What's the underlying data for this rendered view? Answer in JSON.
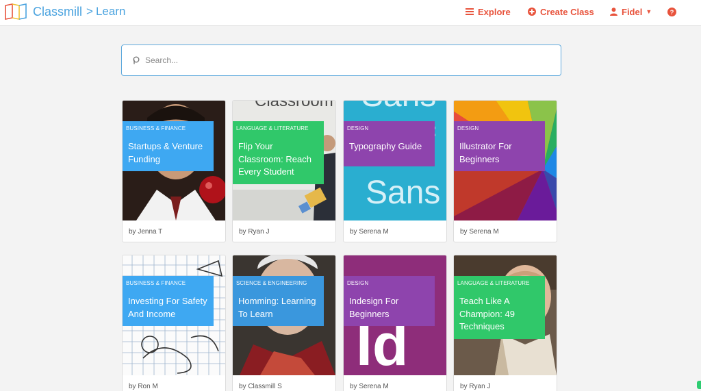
{
  "header": {
    "brand_name": "Classmill",
    "separator": ">",
    "section": "Learn",
    "nav": {
      "explore": "Explore",
      "create_class": "Create Class",
      "user": "Fidel",
      "help_icon": "question-circle-icon"
    }
  },
  "search": {
    "placeholder": "Search..."
  },
  "courses": [
    {
      "category": "Business & Finance",
      "title": "Startups & Venture Funding",
      "author": "by Jenna T",
      "color": "#3ea8f2"
    },
    {
      "category": "Language & Literature",
      "title": "Flip Your Classroom: Reach Every Student",
      "author": "by Ryan J",
      "color": "#30c86a",
      "image_text": "Classroom"
    },
    {
      "category": "Design",
      "title": "Typography Guide",
      "author": "by Serena M",
      "color": "#8e44ad",
      "image_text": "Sans"
    },
    {
      "category": "Design",
      "title": "Illustrator For Beginners",
      "author": "by Serena M",
      "color": "#8e44ad"
    },
    {
      "category": "Business & Finance",
      "title": "Investing For Safety And Income",
      "author": "by Ron M",
      "color": "#3ea8f2"
    },
    {
      "category": "Science & Engineering",
      "title": "Homming: Learning To Learn",
      "author": "by Classmill S",
      "color": "#3a97dd"
    },
    {
      "category": "Design",
      "title": "Indesign For Beginners",
      "author": "by Serena M",
      "color": "#8e44ad",
      "image_text": "Id"
    },
    {
      "category": "Language & Literature",
      "title": "Teach Like A Champion: 49 Techniques",
      "author": "by Ryan J",
      "color": "#30c86a"
    }
  ],
  "colors": {
    "accent": "#e8533c",
    "brand": "#4aa3df",
    "blue": "#3ea8f2",
    "green": "#30c86a",
    "purple": "#8e44ad"
  }
}
